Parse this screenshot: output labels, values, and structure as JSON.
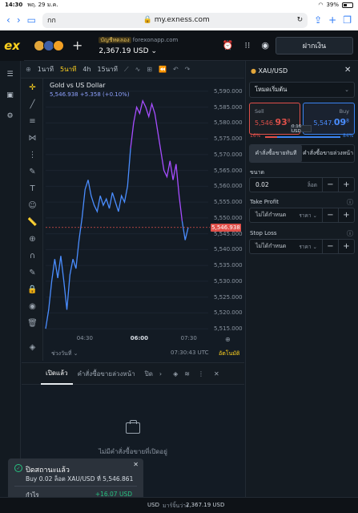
{
  "status_bar": {
    "time": "14:30",
    "date": "พฤ. 29 ม.ค.",
    "battery": "39%"
  },
  "browser": {
    "tab_label": "กก",
    "url": "my.exness.com"
  },
  "header": {
    "logo": "ex",
    "account_type": "บัญชีทดลอง",
    "server": "forexonapp.com",
    "balance": "2,367.19 USD",
    "deposit_label": "ฝากเงิน"
  },
  "chart_toolbar": {
    "timeframes": [
      "1นาที",
      "5นาที",
      "4h",
      "15นาที"
    ],
    "active": "5นาที"
  },
  "chart": {
    "title": "Gold vs US Dollar",
    "legend_price": "5,546.938",
    "legend_change": "+5.358 (+0.10%)",
    "current_price": "5,546.938",
    "time_display": "07:30:43 UTC",
    "range_label": "ช่วงวันที่",
    "auto_label": "อัตโนมัติ",
    "line_color_blue": "#4a8dff",
    "line_color_purple": "#a64dff"
  },
  "chart_data": {
    "type": "line",
    "title": "Gold vs US Dollar",
    "x_ticks": [
      "04:30",
      "06:00",
      "07:30"
    ],
    "y_ticks": [
      5515,
      5520,
      5525,
      5530,
      5535,
      5540,
      5545,
      5550,
      5555,
      5560,
      5565,
      5570,
      5575,
      5580,
      5585,
      5590
    ],
    "y_tick_labels": [
      "5,515.000",
      "5,520.000",
      "5,525.000",
      "5,530.000",
      "5,535.000",
      "5,540.000",
      "5,545.000",
      "5,550.000",
      "5,555.000",
      "5,560.000",
      "5,565.000",
      "5,570.000",
      "5,575.000",
      "5,580.000",
      "5,585.000",
      "5,590.000"
    ],
    "ylim": [
      5513,
      5592
    ],
    "series": [
      {
        "values": [
          5515,
          5521,
          5530,
          5537,
          5531,
          5538,
          5530,
          5521,
          5532,
          5537,
          5534,
          5543,
          5550,
          5559,
          5562,
          5557,
          5554,
          5552,
          5557,
          5554,
          5556,
          5553,
          5558,
          5555,
          5552,
          5557,
          5555,
          5560,
          5572,
          5580,
          5585,
          5583,
          5587,
          5585,
          5582,
          5586,
          5583,
          5577,
          5571,
          5565,
          5563,
          5568,
          5562,
          5567,
          5557,
          5549,
          5543,
          5547
        ]
      }
    ],
    "bold_x_tick": "06:00",
    "grid": true
  },
  "order_panel": {
    "symbol": "XAU/USD",
    "mode": "โหมดเริ่มต้น",
    "sell_label": "Sell",
    "sell_price_main": "5,546.",
    "sell_price_big": "93",
    "sell_price_sup": "8",
    "buy_label": "Buy",
    "buy_price_main": "5,547.",
    "buy_price_big": "09",
    "buy_price_sup": "8",
    "spread": "0.16 USD",
    "sell_pct": "16%",
    "buy_pct": "84%",
    "sell_fraction": 0.16,
    "order_type_market": "คำสั่งซื้อขายทันที",
    "order_type_pending": "คำสั่งซื้อขายล่วงหน้า",
    "volume_label": "ขนาด",
    "volume_value": "0.02",
    "volume_unit": "ล็อต",
    "tp_label": "Take Profit",
    "tp_value": "ไม่ได้กำหนด",
    "tp_unit": "ราคา",
    "sl_label": "Stop Loss",
    "sl_value": "ไม่ได้กำหนด",
    "sl_unit": "ราคา"
  },
  "bottom_panel": {
    "tabs": [
      "เปิดแล้ว",
      "คำสั่งซื้อขายล่วงหน้า",
      "ปิด"
    ],
    "empty_text": "ไม่มีคำสั่งซื้อขายที่เปิดอยู่"
  },
  "toast": {
    "title": "ปิดสถานะแล้ว",
    "detail": "Buy 0.02 ล็อต XAU/USD ที่ 5,546.861",
    "profit_label": "กำไร",
    "profit_value": "+16.07 USD"
  },
  "footer": {
    "currency": "USD",
    "margin_label": "มาร์จิ้นว่าง",
    "margin_value": "2,367.19 USD"
  }
}
